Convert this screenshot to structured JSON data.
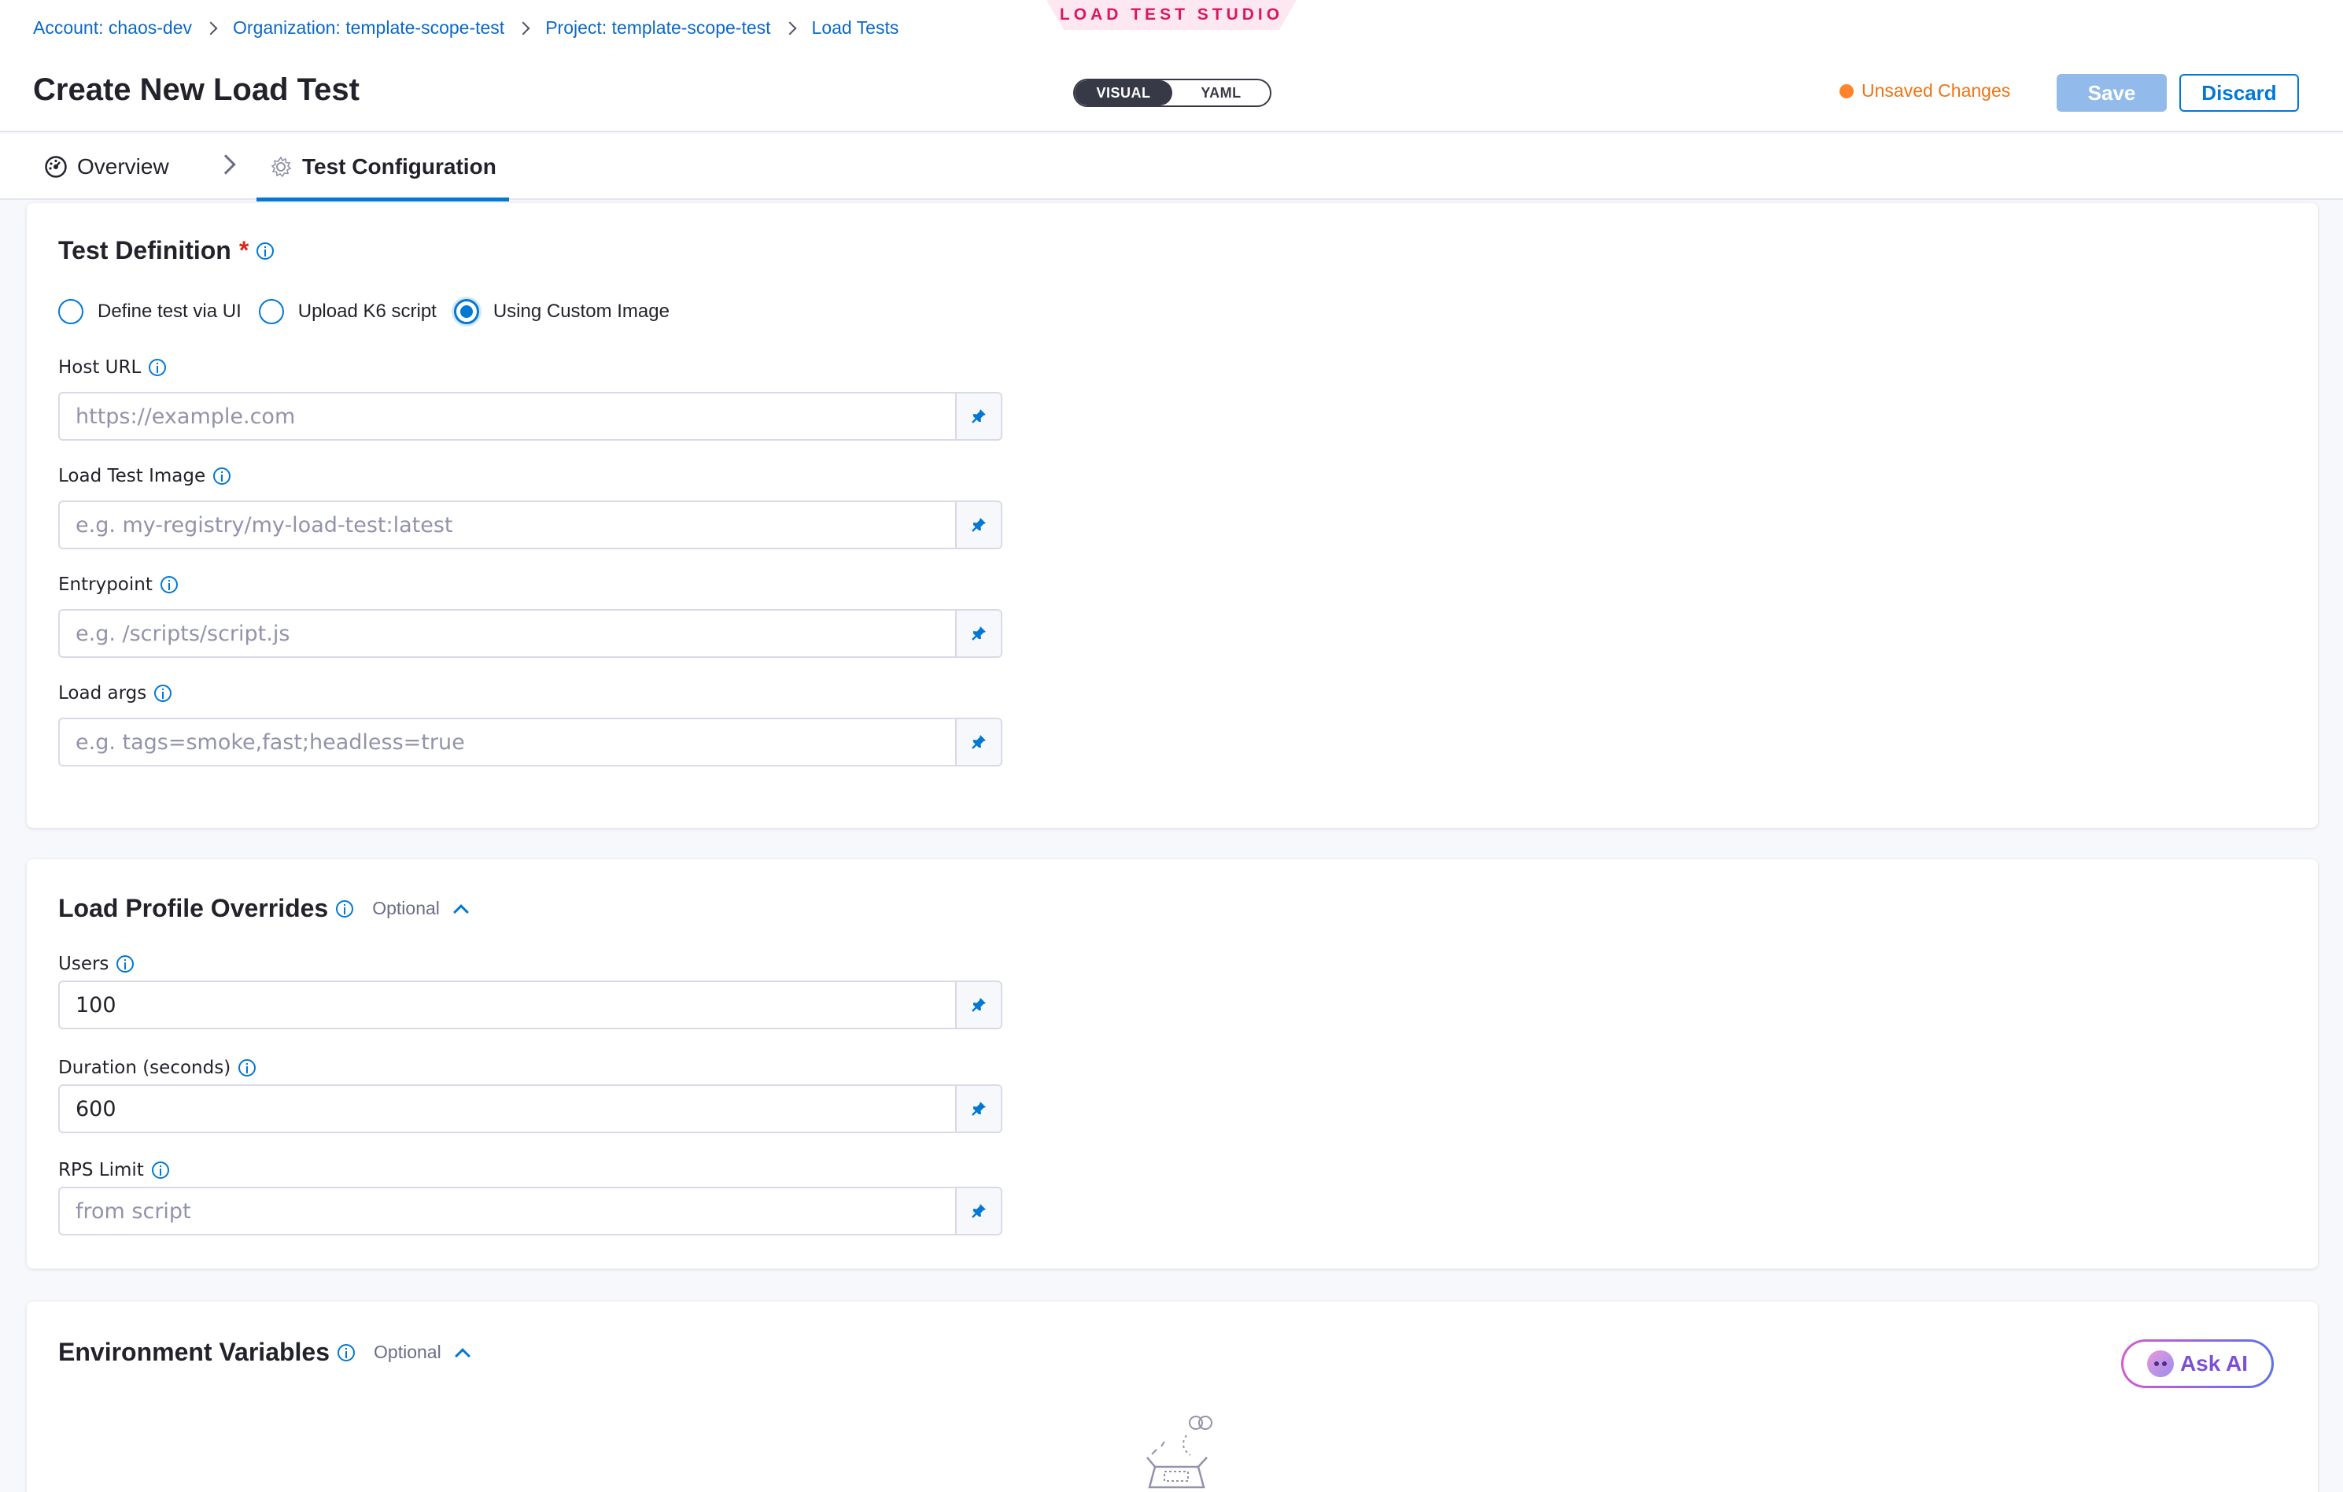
{
  "header": {
    "studio_tag": "LOAD TEST STUDIO",
    "breadcrumb": [
      "Account: chaos-dev",
      "Organization: template-scope-test",
      "Project: template-scope-test",
      "Load Tests"
    ],
    "title": "Create New Load Test",
    "mode_toggle": {
      "visual": "VISUAL",
      "yaml": "YAML",
      "selected": "VISUAL"
    },
    "unsaved_label": "Unsaved Changes",
    "save_label": "Save",
    "discard_label": "Discard"
  },
  "tabs": {
    "overview": "Overview",
    "config": "Test Configuration",
    "active": "Test Configuration"
  },
  "test_definition": {
    "title": "Test Definition",
    "required_mark": "*",
    "options": [
      "Define test via UI",
      "Upload K6 script",
      "Using Custom Image"
    ],
    "selected": "Using Custom Image",
    "fields": {
      "host_url": {
        "label": "Host URL",
        "value": "",
        "placeholder": "https://example.com"
      },
      "image": {
        "label": "Load Test Image",
        "value": "",
        "placeholder": "e.g. my-registry/my-load-test:latest"
      },
      "entrypoint": {
        "label": "Entrypoint",
        "value": "",
        "placeholder": "e.g. /scripts/script.js"
      },
      "args": {
        "label": "Load args",
        "value": "",
        "placeholder": "e.g. tags=smoke,fast;headless=true"
      }
    }
  },
  "load_profile": {
    "title": "Load Profile Overrides",
    "optional_label": "Optional",
    "fields": {
      "users": {
        "label": "Users",
        "value": "100",
        "placeholder": ""
      },
      "duration": {
        "label": "Duration (seconds)",
        "value": "600",
        "placeholder": ""
      },
      "rps": {
        "label": "RPS Limit",
        "value": "",
        "placeholder": "from script"
      }
    }
  },
  "env_vars": {
    "title": "Environment Variables",
    "optional_label": "Optional",
    "ask_ai_label": "Ask AI"
  },
  "colors": {
    "accent": "#0278d5",
    "unsaved": "#ff832b",
    "save_disabled": "#92bbeb",
    "studio_tag": "#d9185f"
  },
  "icons": {
    "breadcrumb_sep": "chevron-right-icon",
    "overview_tab": "dashboard-icon",
    "config_tab": "gear-icon",
    "info": "info-icon",
    "pin": "pin-icon",
    "collapse": "chevron-up-icon",
    "ask_ai": "bot-icon"
  }
}
